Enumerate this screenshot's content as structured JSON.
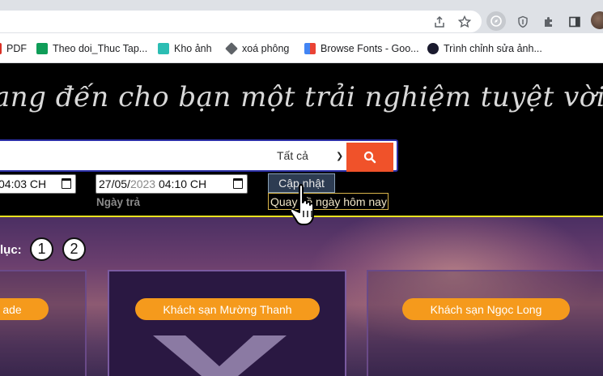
{
  "browser": {
    "bookmarks": [
      {
        "label": "PDF",
        "icon": "pdf-icon",
        "color": "#d93025"
      },
      {
        "label": "Theo doi_Thuc Tap...",
        "icon": "google-sheets-icon",
        "color": "#0f9d58"
      },
      {
        "label": "Kho ảnh",
        "icon": "photo-store-icon",
        "color": "#2bbdb3"
      },
      {
        "label": "xoá phông",
        "icon": "layers-icon",
        "color": "#5f6368"
      },
      {
        "label": "Browse Fonts - Goo...",
        "icon": "google-fonts-icon",
        "color": "#4285f4"
      },
      {
        "label": "Trình chỉnh sửa ảnh...",
        "icon": "photo-editor-icon",
        "color": "#1a1a2e"
      }
    ]
  },
  "header": {
    "slogan": "ang đến cho bạn một trải nghiệm tuyệt vời",
    "category_value": "Tất cả",
    "checkin_value": "04:03 CH",
    "checkout_day": "27/05/",
    "checkout_year": "2023",
    "checkout_time": "04:10 CH",
    "return_label": "Ngày trả",
    "update_label": "Cập nhật",
    "today_label": "Quay về ngày hôm nay"
  },
  "content": {
    "pager_label": "lục:",
    "pages": [
      "1",
      "2"
    ],
    "cards": [
      {
        "label": "ade"
      },
      {
        "label": "Khách sạn Mường Thanh"
      },
      {
        "label": "Khách sạn Ngọc Long"
      }
    ]
  },
  "colors": {
    "accent_orange": "#f59a1c",
    "search_button": "#f0522a",
    "header_border": "#e8e21f"
  }
}
